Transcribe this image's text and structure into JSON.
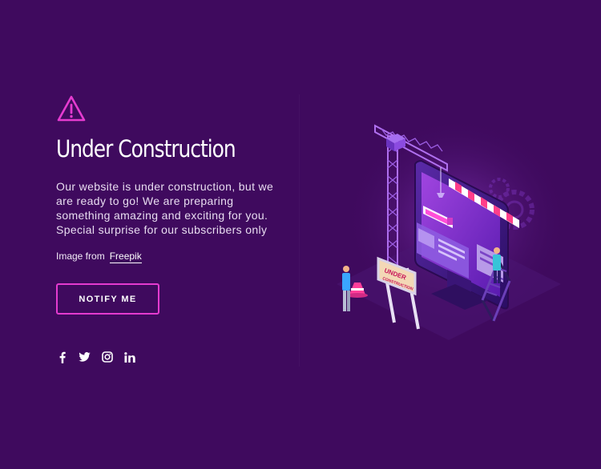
{
  "colors": {
    "background": "#3f0a5e",
    "accent": "#e53bd0",
    "text": "#ffffff"
  },
  "hero": {
    "icon": "warning-triangle-icon",
    "title": "Under Construction",
    "description": "Our website is under construction, but we are ready to go! We are preparing something amazing and exciting for you. Special surprise for our subscribers only",
    "credit_prefix": "Image from",
    "credit_link": "Freepik"
  },
  "cta": {
    "notify_label": "NOTIFY ME"
  },
  "social": [
    {
      "icon": "facebook-icon"
    },
    {
      "icon": "twitter-icon"
    },
    {
      "icon": "instagram-icon"
    },
    {
      "icon": "linkedin-icon"
    }
  ],
  "illustration": {
    "sign_text": "UNDER CONSTRUCTION"
  }
}
